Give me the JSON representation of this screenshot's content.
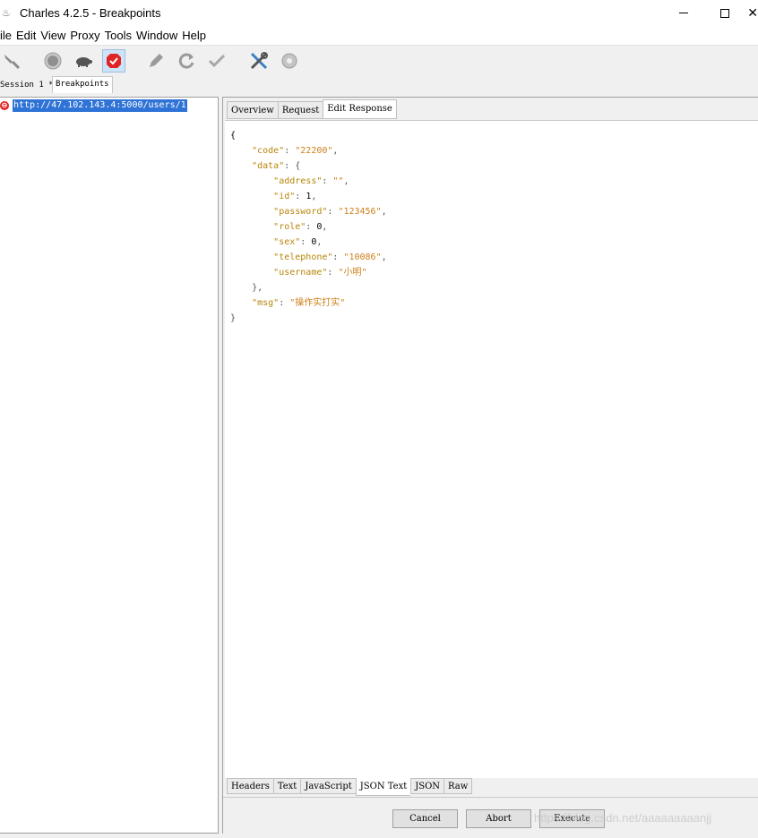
{
  "window": {
    "title": "Charles 4.2.5 - Breakpoints",
    "app_icon": "charles-pot-icon"
  },
  "menu": [
    "File",
    "Edit",
    "View",
    "Proxy",
    "Tools",
    "Window",
    "Help"
  ],
  "menu_visible": [
    "ile",
    "Edit",
    "View",
    "Proxy",
    "Tools",
    "Window",
    "Help"
  ],
  "toolbar": {
    "buttons": [
      {
        "name": "broom-icon"
      },
      {
        "name": "record-icon"
      },
      {
        "name": "turtle-icon"
      },
      {
        "name": "breakpoints-icon"
      },
      {
        "name": "pen-icon"
      },
      {
        "name": "repeat-icon"
      },
      {
        "name": "validate-icon"
      },
      {
        "name": "tools-icon"
      },
      {
        "name": "settings-gear-icon"
      }
    ]
  },
  "session_tabs": [
    "Session 1 *",
    "Breakpoints"
  ],
  "breakpoint": {
    "url": "http://47.102.143.4:5000/users/1"
  },
  "top_tabs": [
    "Overview",
    "Request",
    "Edit Response"
  ],
  "json_lines": {
    "l1": "{",
    "code_key": "\"code\"",
    "code_val": "\"22200\"",
    "data_key": "\"data\"",
    "address_key": "\"address\"",
    "address_val": "\"\"",
    "id_key": "\"id\"",
    "id_val": "1",
    "password_key": "\"password\"",
    "password_val": "\"123456\"",
    "role_key": "\"role\"",
    "role_val": "0",
    "sex_key": "\"sex\"",
    "sex_val": "0",
    "telephone_key": "\"telephone\"",
    "telephone_val": "\"10086\"",
    "username_key": "\"username\"",
    "username_val": "\"小明\"",
    "msg_key": "\"msg\"",
    "msg_val": "\"操作实打实\""
  },
  "bottom_tabs": [
    "Headers",
    "Text",
    "JavaScript",
    "JSON Text",
    "JSON",
    "Raw"
  ],
  "actions": {
    "cancel": "Cancel",
    "abort": "Abort",
    "execute": "Execute"
  },
  "watermark": "https://blog.csdn.net/aaaaaaaaanjj"
}
